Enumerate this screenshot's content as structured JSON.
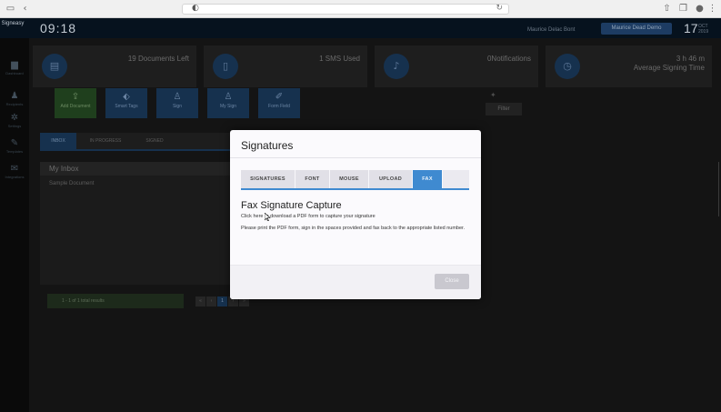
{
  "app": {
    "clock": "09:18",
    "user_name": "Maurice Delac Bont",
    "company": "Maurice Dead Demo",
    "date_day": "17",
    "date_month": "OCT",
    "date_year": "2019",
    "logo": "Signeasy"
  },
  "sidebar": {
    "items": [
      {
        "label": "Dashboard",
        "icon": "folder-icon"
      },
      {
        "label": "Recipients",
        "icon": "user-icon"
      },
      {
        "label": "Settings",
        "icon": "gear-icon"
      },
      {
        "label": "Templates",
        "icon": "pen-icon"
      },
      {
        "label": "Integrations",
        "icon": "mail-icon"
      }
    ]
  },
  "stats": [
    {
      "value": "19 Documents Left",
      "icon": "document-icon"
    },
    {
      "value": "1 SMS Used",
      "icon": "phone-icon"
    },
    {
      "value": "0Notifications",
      "icon": "bell-icon"
    },
    {
      "value": "3 h 46 m",
      "value2": "Average Signing Time",
      "icon": "clock-icon"
    }
  ],
  "actions": [
    {
      "label": "Add Document",
      "icon": "upload-icon"
    },
    {
      "label": "Smart Tags",
      "icon": "tag-icon"
    },
    {
      "label": "Sign",
      "icon": "person-icon"
    },
    {
      "label": "My Sign",
      "icon": "person-icon"
    },
    {
      "label": "Form Field",
      "icon": "edit-icon"
    }
  ],
  "filter_label": "Filter",
  "main_tabs": [
    "INBOX",
    "IN PROGRESS",
    "SIGNED"
  ],
  "inbox": {
    "title": "My Inbox",
    "subtitle": "Sample Document"
  },
  "pager": {
    "info": "1 - 1 of 1 total results",
    "pages": [
      "«",
      "‹",
      "1",
      "›",
      "»"
    ]
  },
  "modal": {
    "title": "Signatures",
    "tabs": [
      "SIGNATURES",
      "FONT",
      "MOUSE",
      "UPLOAD",
      "FAX"
    ],
    "active_tab": "FAX",
    "heading": "Fax Signature Capture",
    "line1_a": "Click",
    "line1_link": "here",
    "line1_b": "to download a PDF form to capture your signature",
    "line2": "Please print the PDF form, sign in the spaces provided and fax back to the appropriate listed number.",
    "close_label": "Close"
  },
  "colors": {
    "accent": "#3f8ad0",
    "header": "#06121e",
    "modal_bg": "#fbfafd"
  }
}
